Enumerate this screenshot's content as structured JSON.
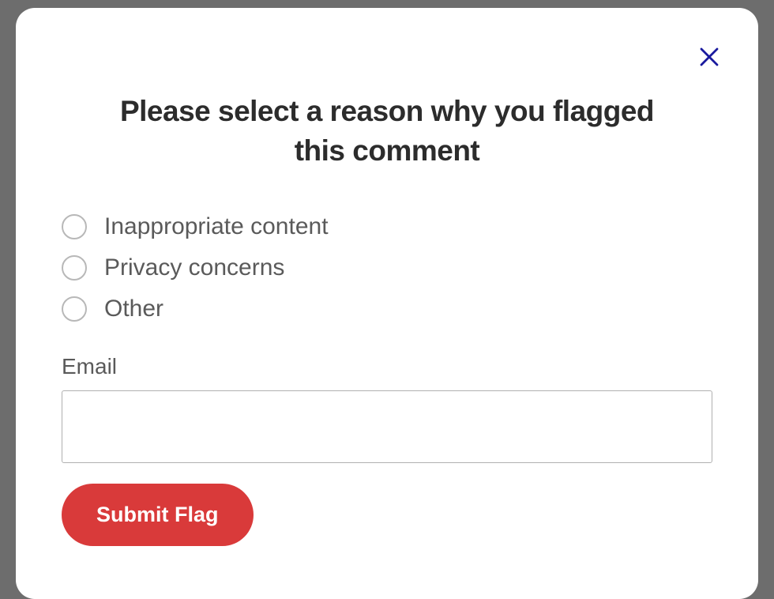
{
  "modal": {
    "title": "Please select a reason why you flagged this comment",
    "reasons": [
      {
        "label": "Inappropriate content"
      },
      {
        "label": "Privacy concerns"
      },
      {
        "label": "Other"
      }
    ],
    "email_label": "Email",
    "email_value": "",
    "submit_label": "Submit Flag"
  }
}
